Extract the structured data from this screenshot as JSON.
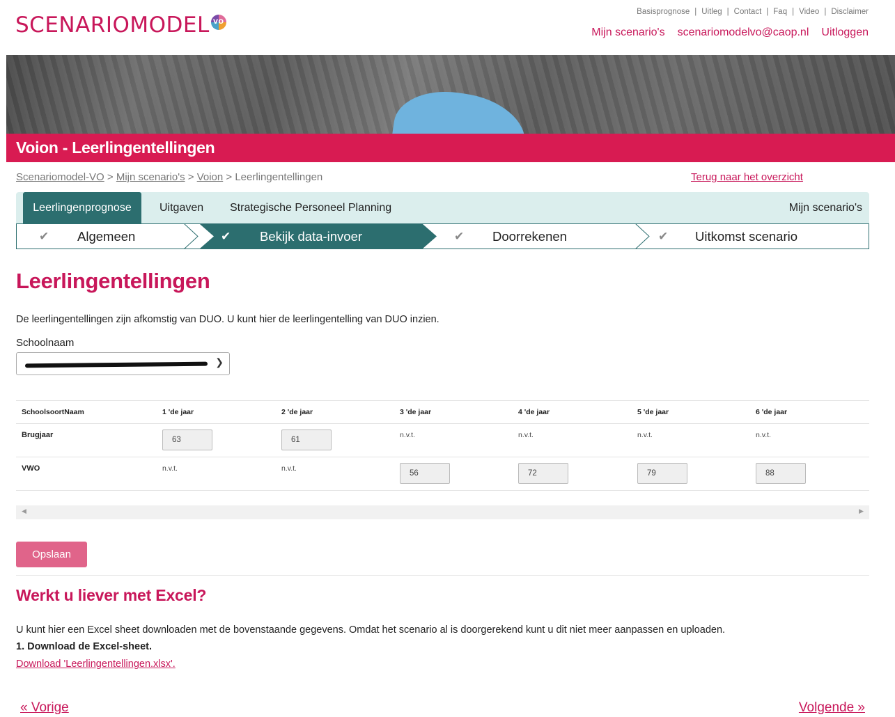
{
  "header": {
    "logo_text": "SCENARIOMODEL",
    "logo_badge": "VO",
    "top_links": [
      "Basisprognose",
      "Uitleg",
      "Contact",
      "Faq",
      "Video",
      "Disclaimer"
    ],
    "user_links": [
      "Mijn scenario's",
      "scenariomodelvo@caop.nl",
      "Uitloggen"
    ]
  },
  "page_title": "Voion - Leerlingentellingen",
  "breadcrumb": {
    "items": [
      "Scenariomodel-VO",
      "Mijn scenario's",
      "Voion"
    ],
    "current": "Leerlingentellingen",
    "separator": ">"
  },
  "back_link": "Terug naar het overzicht",
  "tabs": [
    "Leerlingenprognose",
    "Uitgaven",
    "Strategische Personeel Planning"
  ],
  "tabs_right": "Mijn scenario's",
  "steps": [
    "Algemeen",
    "Bekijk data-invoer",
    "Doorrekenen",
    "Uitkomst scenario"
  ],
  "active_step": 1,
  "main": {
    "heading": "Leerlingentellingen",
    "intro": "De leerlingentellingen zijn afkomstig van DUO. U kunt hier de leerlingentelling van DUO inzien.",
    "school_label": "Schoolnaam"
  },
  "table": {
    "headers": [
      "SchoolsoortNaam",
      "1 'de jaar",
      "2 'de jaar",
      "3 'de jaar",
      "4 'de jaar",
      "5 'de jaar",
      "6 'de jaar"
    ],
    "rows": [
      {
        "name": "Brugjaar",
        "values": [
          "63",
          "61",
          "n.v.t.",
          "n.v.t.",
          "n.v.t.",
          "n.v.t."
        ]
      },
      {
        "name": "VWO",
        "values": [
          "n.v.t.",
          "n.v.t.",
          "56",
          "72",
          "79",
          "88"
        ]
      }
    ]
  },
  "save_label": "Opslaan",
  "excel": {
    "heading": "Werkt u liever met Excel?",
    "text": "U kunt hier een Excel sheet downloaden met de bovenstaande gegevens. Omdat het scenario al is doorgerekend kunt u dit niet meer aanpassen en uploaden.",
    "step": "1. Download de Excel-sheet.",
    "link": "Download 'Leerlingentellingen.xlsx'."
  },
  "nav": {
    "prev": "« Vorige",
    "next": "Volgende »"
  },
  "colors": {
    "brand": "#c8175a",
    "title_bar": "#d81b52",
    "teal": "#2c6e6f",
    "tab_bg": "#dbeeed",
    "save_button": "#e0648a"
  }
}
